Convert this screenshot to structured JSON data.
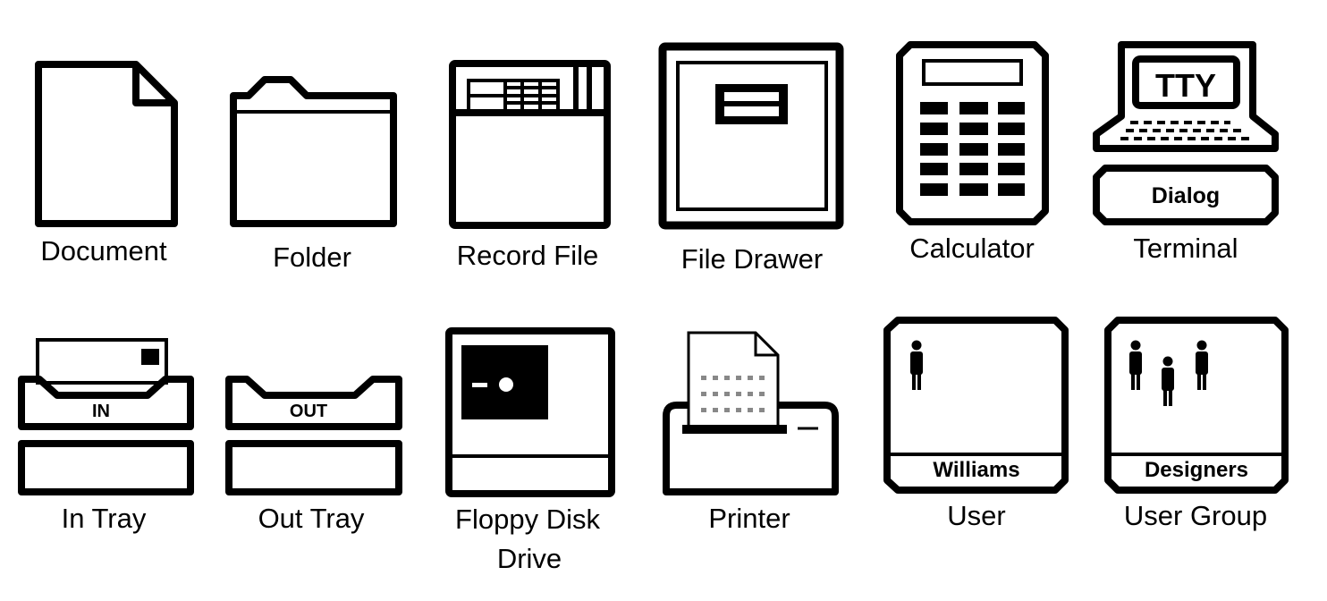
{
  "colors": {
    "ink": "#000000",
    "background": "#ffffff"
  },
  "icons": [
    {
      "id": "document",
      "label": "Document"
    },
    {
      "id": "folder",
      "label": "Folder"
    },
    {
      "id": "record-file",
      "label": "Record File"
    },
    {
      "id": "file-drawer",
      "label": "File Drawer"
    },
    {
      "id": "calculator",
      "label": "Calculator"
    },
    {
      "id": "terminal",
      "label": "Terminal",
      "screen_text": "TTY",
      "box_text": "Dialog"
    },
    {
      "id": "in-tray",
      "label": "In Tray",
      "tray_text": "IN"
    },
    {
      "id": "out-tray",
      "label": "Out Tray",
      "tray_text": "OUT"
    },
    {
      "id": "floppy-disk-drive",
      "label_line1": "Floppy Disk",
      "label_line2": "Drive"
    },
    {
      "id": "printer",
      "label": "Printer"
    },
    {
      "id": "user",
      "label": "User",
      "name": "Williams"
    },
    {
      "id": "user-group",
      "label": "User Group",
      "name": "Designers"
    }
  ]
}
